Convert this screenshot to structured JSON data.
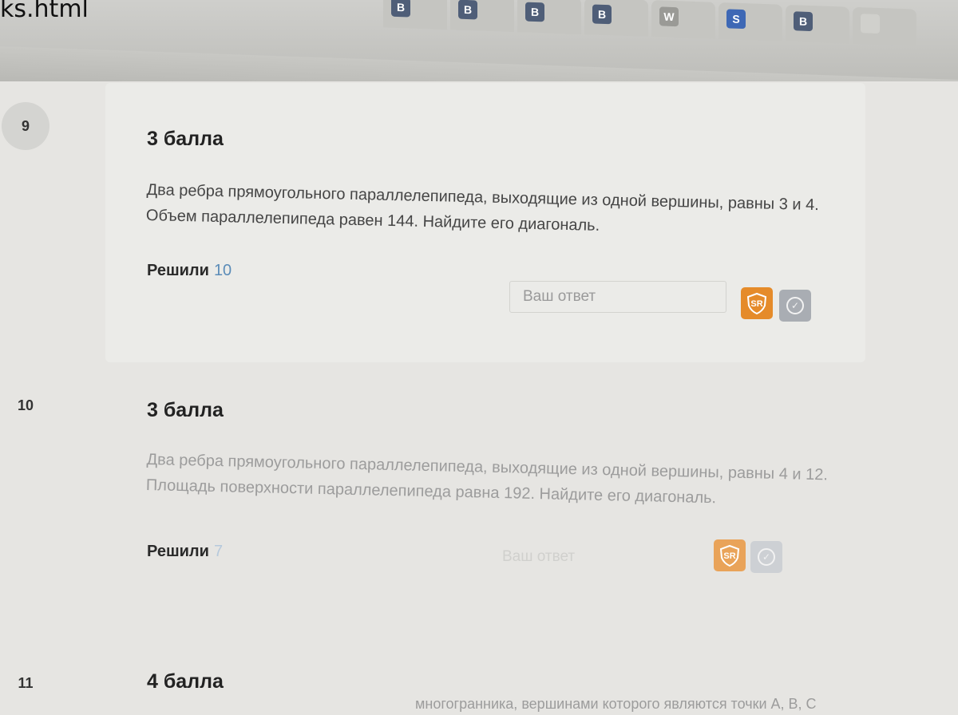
{
  "browser": {
    "file_name": "ks.html",
    "tabs": [
      {
        "icon": "B"
      },
      {
        "icon": "B"
      },
      {
        "icon": "B"
      },
      {
        "icon": "B"
      },
      {
        "icon": "W"
      },
      {
        "icon": "S"
      },
      {
        "icon": "B"
      },
      {
        "icon": ""
      }
    ]
  },
  "tasks": [
    {
      "number": "9",
      "points": "3 балла",
      "question": "Два ребра прямоугольного параллелепипеда, выходящие из одной вершины, равны 3 и 4. Объем параллелепипеда равен 144. Найдите его диагональ.",
      "solved_label": "Решили",
      "solved_count": "10",
      "answer_placeholder": "Ваш ответ",
      "sr_label": "SR"
    },
    {
      "number": "10",
      "points": "3 балла",
      "question": "Два ребра прямоугольного параллелепипеда, выходящие из одной вершины, равны 4 и 12. Площадь поверхности параллелепипеда равна 192. Найдите его диагональ.",
      "solved_label": "Решили",
      "solved_count": "7",
      "answer_placeholder": "Ваш ответ",
      "sr_label": "SR"
    },
    {
      "number": "11",
      "points": "4 балла",
      "question_fragment": "многогранника, вершинами которого являются точки A, B, C"
    }
  ]
}
